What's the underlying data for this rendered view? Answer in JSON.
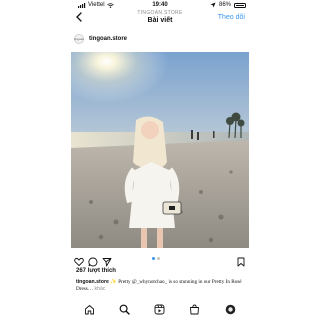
{
  "status_bar": {
    "carrier": "Viettel",
    "time": "19:40",
    "battery": "86%"
  },
  "nav": {
    "account_label": "TINGOAN.STORE",
    "title": "Bài viết",
    "follow_label": "Theo dõi"
  },
  "post": {
    "username": "tingoan.store",
    "avatar_text": "tingoan",
    "likes": "267 lượt thích",
    "caption": {
      "user": "tingoan.store",
      "text": "Pretty @_whynotchao_ is so stunning in our Pretty In Rosé Dress…",
      "more": "khác"
    },
    "carousel": {
      "count": 2,
      "active": 1
    }
  },
  "icons": {
    "actions": [
      "heart-icon",
      "comment-icon",
      "share-icon",
      "bookmark-icon"
    ],
    "tabs": [
      "home-icon",
      "search-icon",
      "reels-icon",
      "shop-icon",
      "profile-icon"
    ]
  },
  "colors": {
    "accent": "#3897f0",
    "text": "#111111",
    "muted": "#8e8e8e"
  }
}
